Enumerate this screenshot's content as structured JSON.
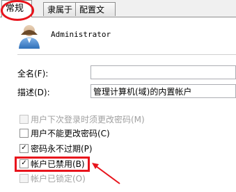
{
  "tabs": [
    {
      "label": "常规",
      "active": true
    },
    {
      "label": "隶属于",
      "active": false
    },
    {
      "label": "配置文件",
      "active": false
    }
  ],
  "user": {
    "name": "Administrator"
  },
  "fields": {
    "fullname": {
      "label": "全名(F):",
      "value": ""
    },
    "description": {
      "label": "描述(D):",
      "value": "管理计算机(域)的内置帐户"
    }
  },
  "options": [
    {
      "label": "用户下次登录时须更改密码(M)",
      "checked": false,
      "enabled": false
    },
    {
      "label": "用户不能更改密码(C)",
      "checked": false,
      "enabled": true
    },
    {
      "label": "密码永不过期(P)",
      "checked": true,
      "enabled": true
    },
    {
      "label": "帐户已禁用(B)",
      "checked": true,
      "enabled": true
    },
    {
      "label": "帐户已锁定(O)",
      "checked": false,
      "enabled": false
    }
  ],
  "colors": {
    "annotation": "#e8141c",
    "window_bg": "#f0f0f0"
  },
  "icons": {
    "avatar": "user-account-icon"
  }
}
